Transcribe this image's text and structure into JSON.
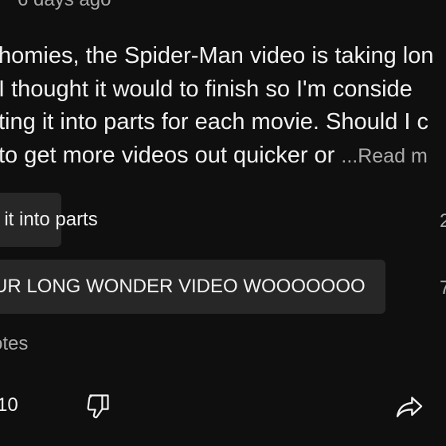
{
  "post": {
    "timestamp": "6 days ago",
    "lines": [
      "homies, the Spider-Man video is taking lon",
      " I thought it would to finish so I'm conside",
      "ting it into parts for each movie. Should I c",
      "to get more videos out quicker or "
    ],
    "read_more": "...Read m"
  },
  "poll": {
    "options": [
      {
        "label": "t it into parts",
        "percent": "2"
      },
      {
        "label": "UR LONG WONDER VIDEO WOOOOOOO",
        "percent": "7"
      }
    ],
    "votes_label": "otes"
  },
  "actions": {
    "like_count": "10",
    "icons": [
      "dislike-icon",
      "share-icon"
    ]
  }
}
